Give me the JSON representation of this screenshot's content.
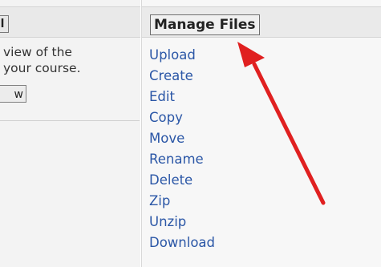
{
  "left": {
    "header_label": "l",
    "description_line1": "view of the",
    "description_line2": "your course.",
    "view_button_label": "w"
  },
  "right": {
    "header_button_label": "Manage Files",
    "menu": [
      "Upload",
      "Create",
      "Edit",
      "Copy",
      "Move",
      "Rename",
      "Delete",
      "Zip",
      "Unzip",
      "Download"
    ]
  },
  "colors": {
    "link": "#2a56a6",
    "arrow": "#e02020"
  },
  "icons": {
    "annotation": "red-arrow-icon"
  }
}
